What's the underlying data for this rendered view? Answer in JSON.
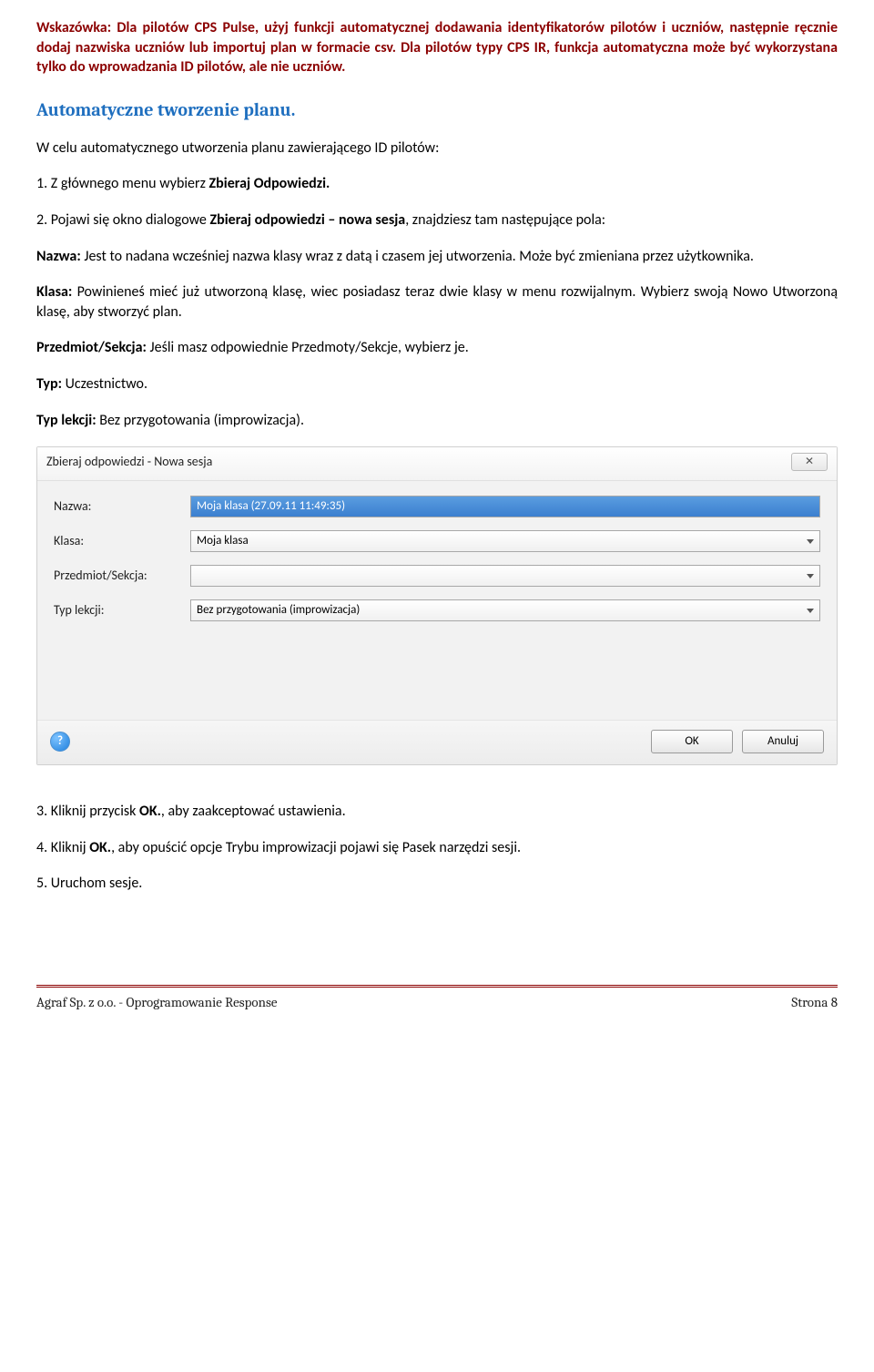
{
  "hint": {
    "prefix": "Wskazówka:",
    "text": " Dla pilotów CPS Pulse, użyj funkcji automatycznej dodawania identyfikatorów pilotów i uczniów, następnie ręcznie dodaj nazwiska uczniów lub importuj plan w formacie csv. Dla pilotów typy CPS IR, funkcja automatyczna może być wykorzystana tylko do wprowadzania ID pilotów, ale nie uczniów."
  },
  "heading": "Automatyczne tworzenie planu.",
  "intro": "W celu automatycznego utworzenia planu zawierającego ID pilotów:",
  "step1_a": "1. Z głównego menu wybierz ",
  "step1_b": "Zbieraj Odpowiedzi.",
  "step2_a": "2. Pojawi się okno dialogowe ",
  "step2_b": "Zbieraj odpowiedzi – nowa sesja",
  "step2_c": ", znajdziesz tam następujące pola:",
  "nazwa_label": "Nazwa:",
  "nazwa_text": " Jest to nadana wcześniej nazwa klasy wraz z datą i czasem jej utworzenia. Może być zmieniana przez użytkownika.",
  "klasa_label": "Klasa:",
  "klasa_text": " Powinieneś mieć już utworzoną klasę, wiec posiadasz teraz dwie klasy w menu rozwijalnym. Wybierz swoją Nowo Utworzoną klasę, aby stworzyć plan.",
  "przedmiot_label": "Przedmiot/Sekcja:",
  "przedmiot_text": " Jeśli masz odpowiednie Przedmoty/Sekcje, wybierz je.",
  "typ_label": "Typ:",
  "typ_text": "  Uczestnictwo.",
  "typlekcji_label": "Typ lekcji:",
  "typlekcji_text": " Bez przygotowania (improwizacja).",
  "dialog": {
    "title": "Zbieraj odpowiedzi - Nowa sesja",
    "close": "✕",
    "fields": {
      "nazwa": {
        "label": "Nazwa:",
        "value": "Moja klasa (27.09.11 11:49:35)"
      },
      "klasa": {
        "label": "Klasa:",
        "value": "Moja klasa"
      },
      "przedmiot": {
        "label": "Przedmiot/Sekcja:",
        "value": ""
      },
      "typlekcji": {
        "label": "Typ lekcji:",
        "value": "Bez przygotowania (improwizacja)"
      }
    },
    "help": "?",
    "ok": "OK",
    "cancel": "Anuluj"
  },
  "step3_a": "3. Kliknij przycisk ",
  "step3_b": "OK.",
  "step3_c": ", aby zaakceptować ustawienia.",
  "step4_a": "4. Kliknij ",
  "step4_b": "OK.",
  "step4_c": ", aby opuścić opcje Trybu improwizacji pojawi się Pasek narzędzi sesji.",
  "step5": "5. Uruchom sesje.",
  "footer": {
    "left": "Agraf Sp. z o.o. - Oprogramowanie Response",
    "right": "Strona 8"
  }
}
